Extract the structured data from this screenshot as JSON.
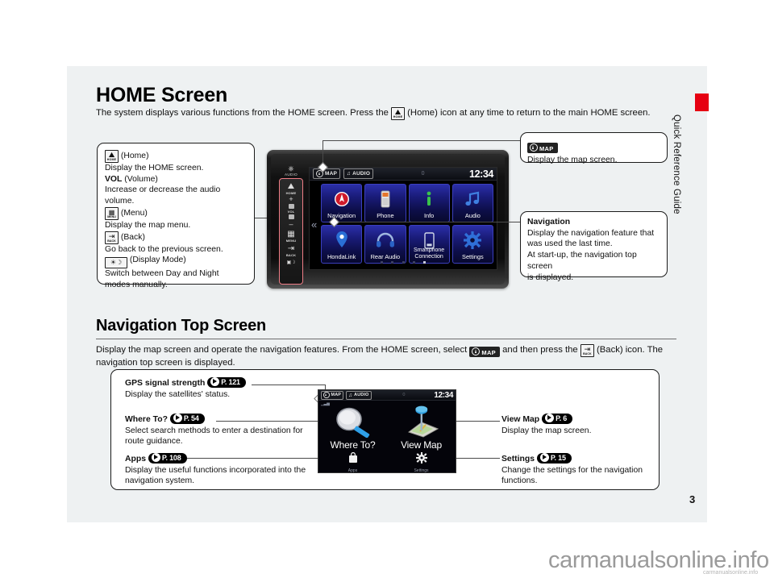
{
  "sidebar": {
    "tab_label": "Quick Reference Guide",
    "tab_color": "#e60012"
  },
  "page_number": "3",
  "watermark": {
    "big": "carmanualsonline.info",
    "small": "carmanualsonline.info"
  },
  "section_home": {
    "title": "HOME Screen",
    "intro_before": "The system displays various functions from the HOME screen. Press the",
    "intro_after": "(Home) icon at any time to return to the main HOME screen.",
    "intro_icon": "home-key-icon"
  },
  "left_callout": {
    "items": [
      {
        "icon": "home-key-icon",
        "name": "(Home)",
        "desc": "Display the HOME screen."
      },
      {
        "icon": "",
        "name": "VOL",
        "name_rest": " (Volume)",
        "desc": "Increase or decrease the audio volume."
      },
      {
        "icon": "menu-key-icon",
        "name": "(Menu)",
        "desc": "Display the map menu."
      },
      {
        "icon": "back-key-icon",
        "name": "(Back)",
        "desc": "Go back to the previous screen."
      },
      {
        "icon": "display-mode-key-icon",
        "name": "(Display Mode)",
        "desc": "Switch between Day and Night modes manually."
      }
    ],
    "labels": {
      "home": "(Home)",
      "home_desc": "Display the HOME screen.",
      "vol_bold": "VOL",
      "vol_rest": "(Volume)",
      "vol_desc_1": "Increase or decrease the audio",
      "vol_desc_2": "volume.",
      "menu": "(Menu)",
      "menu_desc": "Display the map menu.",
      "back": "(Back)",
      "back_desc": "Go back to the previous screen.",
      "dmode": "(Display Mode)",
      "dmode_desc_1": "Switch between Day and Night",
      "dmode_desc_2": "modes manually."
    }
  },
  "map_callout": {
    "badge_text": "MAP",
    "desc": "Display the map screen."
  },
  "navigation_callout": {
    "title": "Navigation",
    "line1": "Display the navigation feature that",
    "line2": "was used the last time.",
    "line3": "At start-up, the navigation top screen",
    "line4": "is displayed."
  },
  "head_unit": {
    "audio_knob": {
      "label": "AUDIO",
      "icon": "power-icon"
    },
    "buttons": [
      {
        "name": "HOME",
        "icon": "home-icon"
      },
      {
        "name": "VOL",
        "icon": "volume-slider-icon"
      },
      {
        "name": "MENU",
        "icon": "menu-icon"
      },
      {
        "name": "BACK",
        "icon": "back-arrow-icon"
      },
      {
        "name": "",
        "icon": "display-mode-icon"
      }
    ],
    "status_bar": {
      "map_tag": "MAP",
      "audio_tag": "AUDIO",
      "center": "0",
      "clock": "12:34"
    },
    "tiles_row1": [
      {
        "label": "Navigation",
        "icon": "navigation-compass-icon"
      },
      {
        "label": "Phone",
        "icon": "phone-icon"
      },
      {
        "label": "Info",
        "icon": "info-icon"
      },
      {
        "label": "Audio",
        "icon": "music-note-icon"
      }
    ],
    "tiles_row2": [
      {
        "label": "HondaLink",
        "icon": "hondalink-pin-icon"
      },
      {
        "label": "Rear Audio",
        "icon": "headphones-icon"
      },
      {
        "label": "Smartphone Connection",
        "icon": "smartphone-icon"
      },
      {
        "label": "Settings",
        "icon": "gear-icon"
      }
    ],
    "page_dots": 5,
    "page_dot_active": 5,
    "chevron": "«"
  },
  "section_nav": {
    "title": "Navigation Top Screen",
    "intro_1": "Display the map screen and operate the navigation features. From the HOME screen, select",
    "intro_2": "and then press the",
    "intro_3": "(Back) icon. The",
    "intro_4": "navigation top screen is displayed.",
    "map_badge": "MAP"
  },
  "nav_callouts_left": [
    {
      "title": "GPS signal strength",
      "ref": "P. 121",
      "desc_1": "Display the satellites' status.",
      "desc_2": ""
    },
    {
      "title": "Where To?",
      "ref": "P. 54",
      "desc_1": "Select search methods to enter a destination for",
      "desc_2": "route guidance."
    },
    {
      "title": "Apps",
      "ref": "P. 108",
      "desc_1": "Display the useful functions incorporated into the",
      "desc_2": "navigation system."
    }
  ],
  "nav_callouts_right": [
    {
      "title": "View Map",
      "ref": "P. 6",
      "desc_1": "Display the map screen.",
      "desc_2": ""
    },
    {
      "title": "Settings",
      "ref": "P. 15",
      "desc_1": "Change the settings for the navigation",
      "desc_2": "functions."
    }
  ],
  "nav_screen": {
    "status_bar": {
      "map_tag": "MAP",
      "audio_tag": "AUDIO",
      "center": "0",
      "clock": "12:34"
    },
    "gps_indicator": "gps-bars-icon",
    "where_to_label": "Where To?",
    "where_to_icon": "magnifier-icon",
    "view_map_label": "View Map",
    "view_map_icon": "map-pin-icon",
    "apps_label": "Apps",
    "apps_icon": "apps-bag-icon",
    "settings_label": "Settings",
    "settings_icon": "gear-icon"
  }
}
